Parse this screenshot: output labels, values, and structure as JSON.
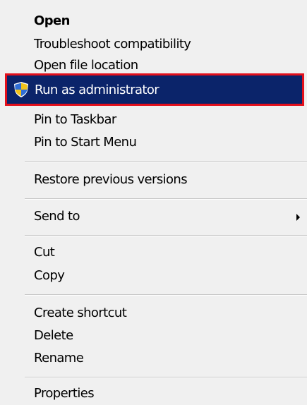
{
  "context_menu": {
    "items": {
      "open": "Open",
      "troubleshoot": "Troubleshoot compatibility",
      "open_location": "Open file location",
      "run_as_admin": "Run as administrator",
      "pin_taskbar": "Pin to Taskbar",
      "pin_start": "Pin to Start Menu",
      "restore": "Restore previous versions",
      "send_to": "Send to",
      "cut": "Cut",
      "copy": "Copy",
      "create_shortcut": "Create shortcut",
      "delete": "Delete",
      "rename": "Rename",
      "properties": "Properties"
    },
    "highlighted_item": "run_as_admin",
    "icons": {
      "run_as_admin": "uac-shield-icon",
      "send_to": "submenu-arrow-icon"
    },
    "colors": {
      "background": "#f0f0f0",
      "highlight": "#0b246a",
      "highlight_outline": "#e3101c",
      "text": "#000000",
      "highlight_text": "#ffffff"
    }
  }
}
